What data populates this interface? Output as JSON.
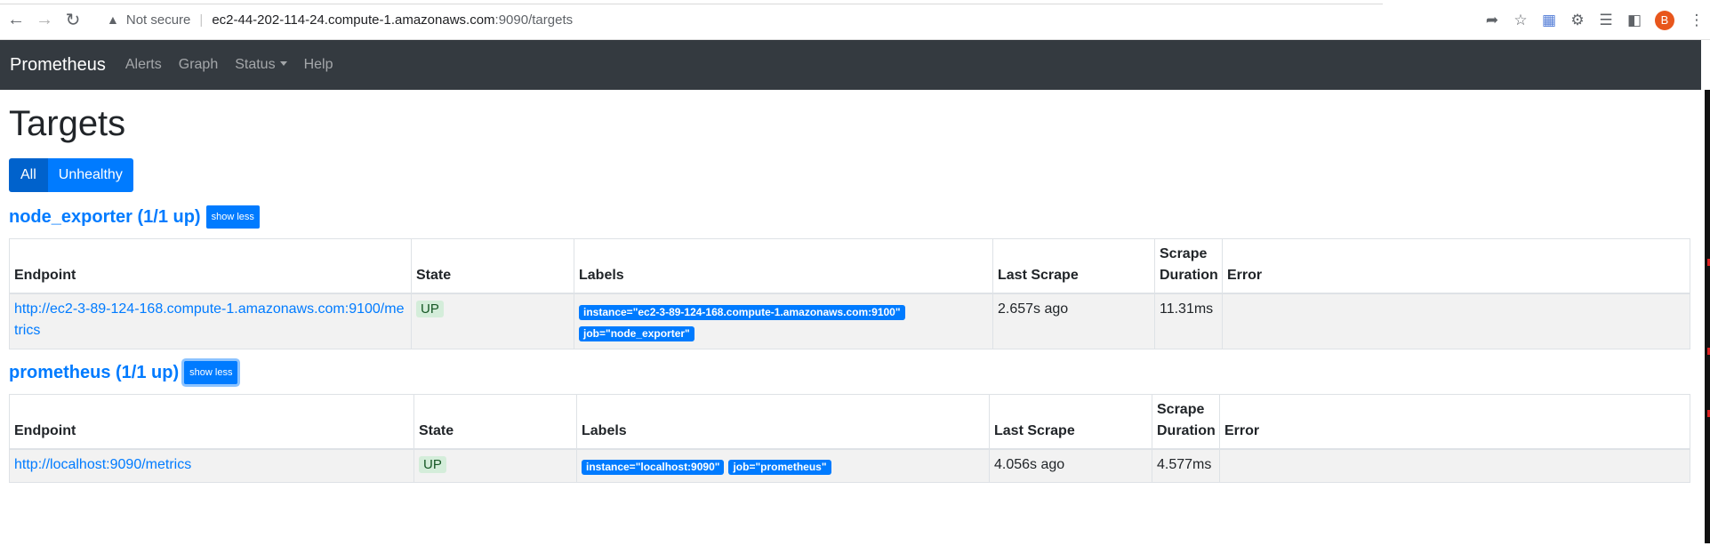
{
  "browser": {
    "security_label": "Not secure",
    "url_host": "ec2-44-202-114-24.compute-1.amazonaws.com",
    "url_path": ":9090/targets",
    "avatar_letter": "B"
  },
  "navbar": {
    "brand": "Prometheus",
    "links": {
      "alerts": "Alerts",
      "graph": "Graph",
      "status": "Status",
      "help": "Help"
    }
  },
  "page": {
    "title": "Targets",
    "filter": {
      "all": "All",
      "unhealthy": "Unhealthy"
    }
  },
  "columns": {
    "endpoint": "Endpoint",
    "state": "State",
    "labels": "Labels",
    "last_scrape": "Last Scrape",
    "scrape_duration": "Scrape Duration",
    "error": "Error"
  },
  "sections": [
    {
      "title": "node_exporter (1/1 up)",
      "toggle": "show less",
      "row": {
        "endpoint": "http://ec2-3-89-124-168.compute-1.amazonaws.com:9100/metrics",
        "state": "UP",
        "labels": [
          "instance=\"ec2-3-89-124-168.compute-1.amazonaws.com:9100\"",
          "job=\"node_exporter\""
        ],
        "last_scrape": "2.657s ago",
        "scrape_duration": "11.31ms",
        "error": ""
      }
    },
    {
      "title": "prometheus (1/1 up)",
      "toggle": "show less",
      "row": {
        "endpoint": "http://localhost:9090/metrics",
        "state": "UP",
        "labels": [
          "instance=\"localhost:9090\"",
          "job=\"prometheus\""
        ],
        "last_scrape": "4.056s ago",
        "scrape_duration": "4.577ms",
        "error": ""
      }
    }
  ]
}
